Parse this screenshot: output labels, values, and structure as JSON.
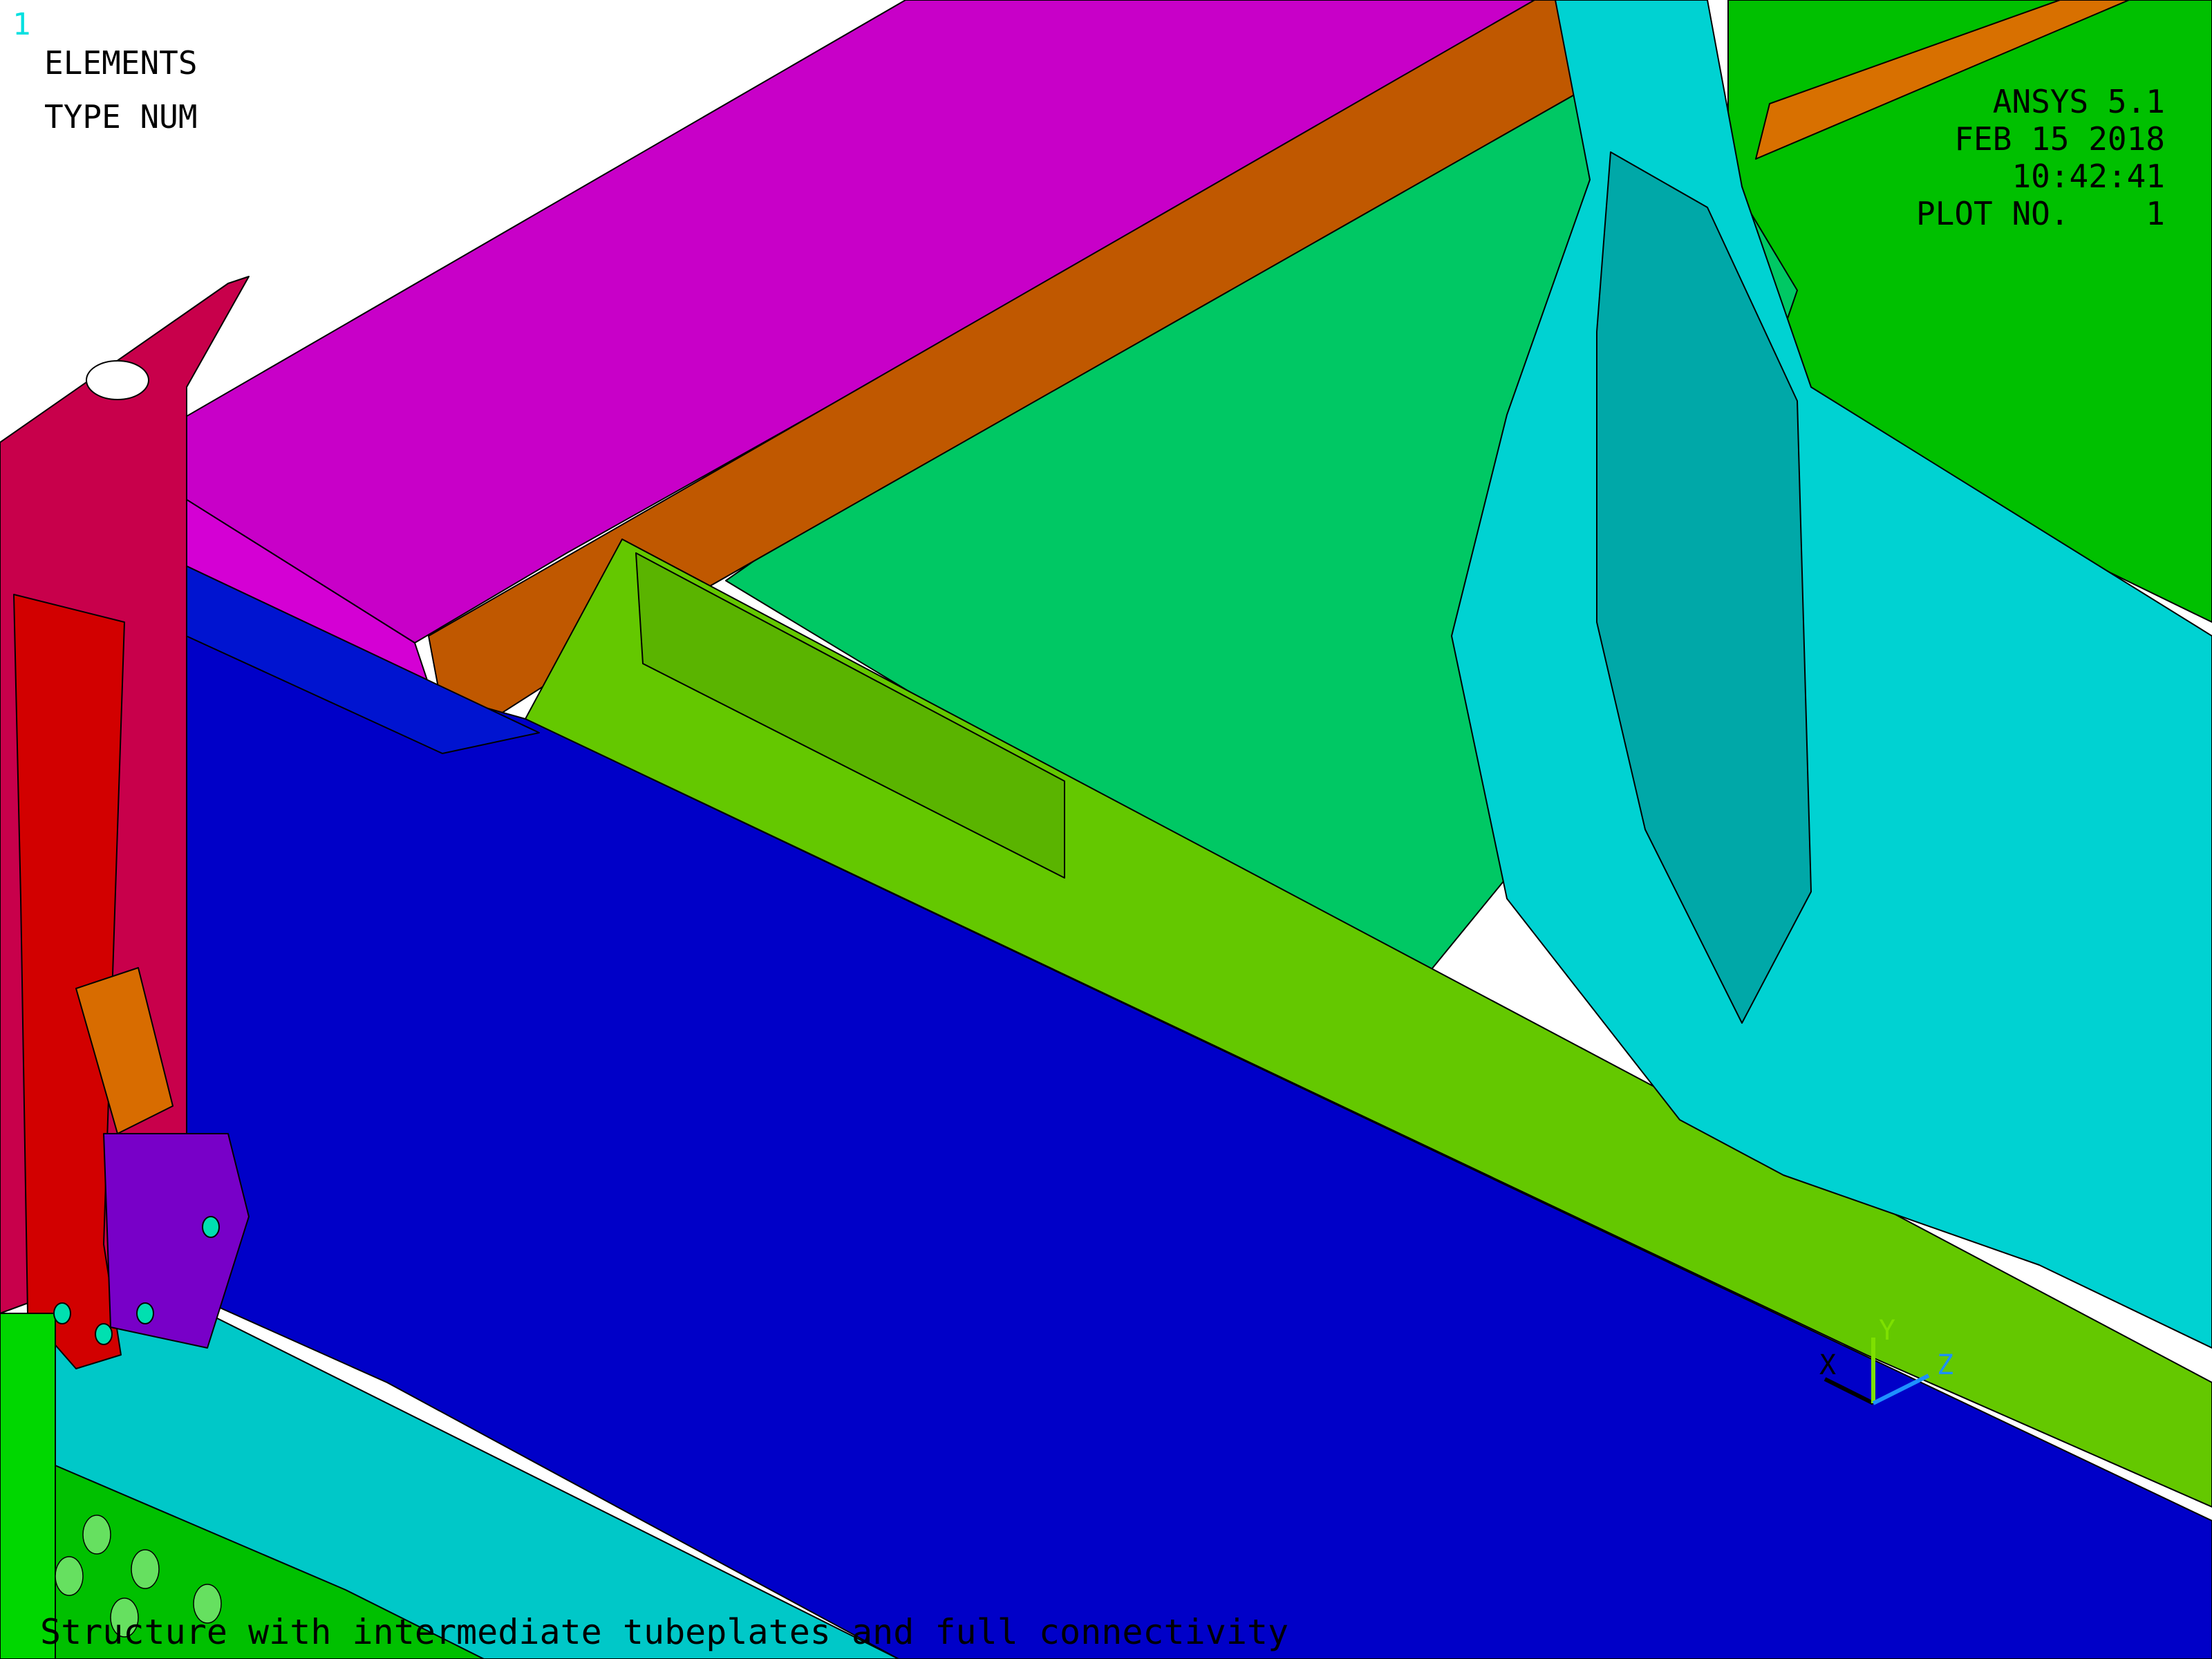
{
  "window": {
    "number": "1"
  },
  "plot": {
    "label": "ELEMENTS",
    "type_label": "TYPE NUM",
    "program": "ANSYS 5.1",
    "date": "FEB 15 2018",
    "time": "10:42:41",
    "plot_number": "PLOT NO.    1",
    "title": "Structure with intermediate tubeplates and full connectivity"
  },
  "triad": {
    "x_label": "X",
    "y_label": "Y",
    "z_label": "Z"
  },
  "colors": {
    "background": "#ffffff",
    "magenta_flange": "#c800c8",
    "orange_strip": "#c05800",
    "green_plate": "#00c864",
    "lime_beam": "#64c800",
    "blue_web": "#0000c8",
    "cyan_shell": "#00d2d2",
    "crimson_bracket": "#c8004b",
    "red_column": "#d20000",
    "bright_green": "#00d700",
    "purple_part": "#7800c8",
    "triad_y": "#7ee000",
    "triad_z": "#1e90ff"
  }
}
